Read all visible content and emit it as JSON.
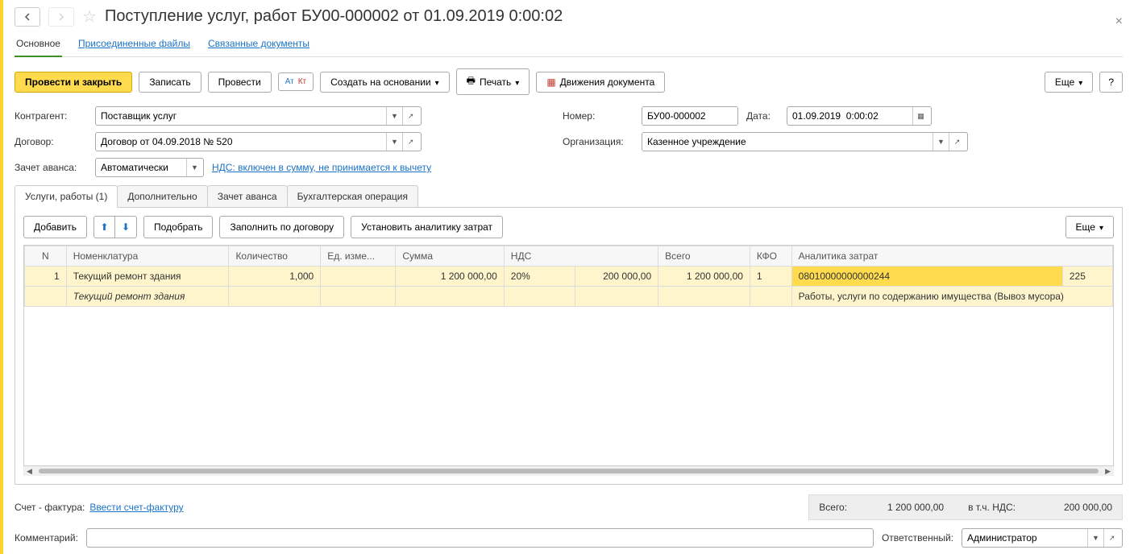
{
  "title": "Поступление услуг, работ БУ00-000002 от 01.09.2019 0:00:02",
  "navLinks": {
    "main": "Основное",
    "files": "Присоединенные файлы",
    "related": "Связанные документы"
  },
  "toolbar": {
    "postAndClose": "Провести и закрыть",
    "save": "Записать",
    "post": "Провести",
    "createBased": "Создать на основании",
    "print": "Печать",
    "movements": "Движения документа",
    "more": "Еще",
    "help": "?"
  },
  "form": {
    "counterparty_label": "Контрагент:",
    "counterparty": "Поставщик услуг",
    "contract_label": "Договор:",
    "contract": "Договор от 04.09.2018 № 520",
    "advance_label": "Зачет аванса:",
    "advance": "Автоматически",
    "vat_link": "НДС: включен в сумму, не принимается к вычету",
    "number_label": "Номер:",
    "number": "БУ00-000002",
    "date_label": "Дата:",
    "date": "01.09.2019  0:00:02",
    "org_label": "Организация:",
    "org": "Казенное учреждение"
  },
  "tabs": {
    "services": "Услуги, работы (1)",
    "additional": "Дополнительно",
    "advance": "Зачет аванса",
    "accounting": "Бухгалтерская операция"
  },
  "tableToolbar": {
    "add": "Добавить",
    "pick": "Подобрать",
    "fillContract": "Заполнить по договору",
    "setAnalytics": "Установить аналитику затрат",
    "more": "Еще"
  },
  "columns": {
    "n": "N",
    "nomenclature": "Номенклатура",
    "qty": "Количество",
    "unit": "Ед. изме...",
    "sum": "Сумма",
    "vat": "НДС",
    "vatAmt": "",
    "total": "Всего",
    "kfo": "КФО",
    "analytics": "Аналитика затрат",
    "analytics2": ""
  },
  "row": {
    "n": "1",
    "name": "Текущий ремонт здания",
    "name2": "Текущий ремонт здания",
    "qty": "1,000",
    "sum": "1 200 000,00",
    "vat_rate": "20%",
    "vat_amt": "200 000,00",
    "total": "1 200 000,00",
    "kfo": "1",
    "code": "08010000000000244",
    "kosgu": "225",
    "desc": "Работы, услуги по содержанию имущества (Вывоз мусора)"
  },
  "footer": {
    "invoice_label": "Счет - фактура:",
    "invoice_link": "Ввести счет-фактуру",
    "totals_label": "Всего:",
    "totals_sum": "1 200 000,00",
    "vat_label": "в т.ч. НДС:",
    "vat_sum": "200 000,00",
    "comment_label": "Комментарий:",
    "comment": "",
    "responsible_label": "Ответственный:",
    "responsible": "Администратор"
  }
}
